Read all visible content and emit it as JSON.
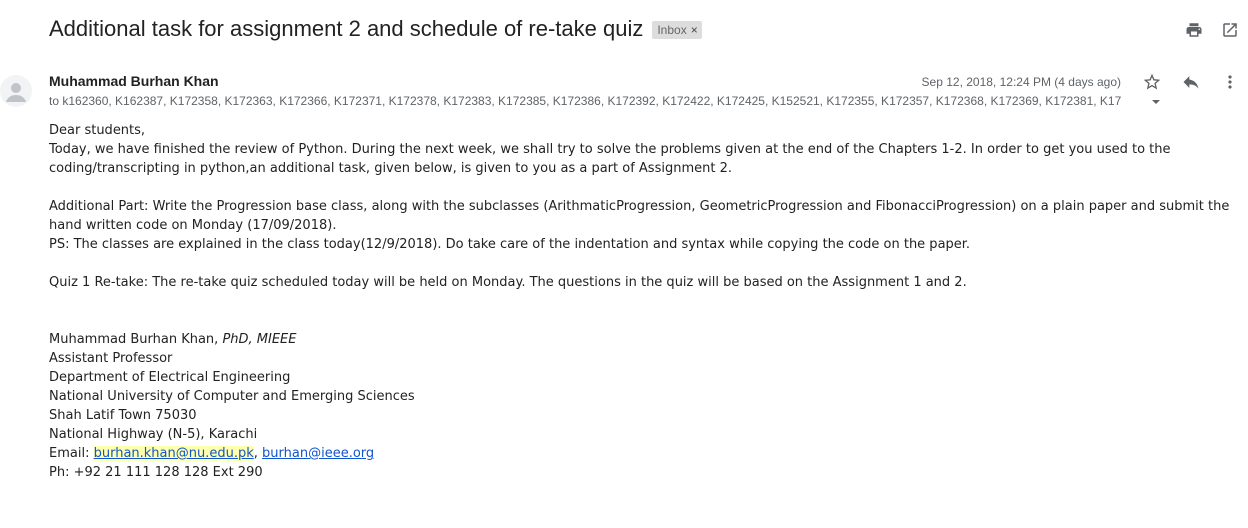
{
  "email": {
    "subject": "Additional task for assignment 2 and schedule of re-take quiz",
    "label": "Inbox",
    "label_remove": "×",
    "sender": "Muhammad Burhan Khan",
    "date": "Sep 12, 2018, 12:24 PM (4 days ago)",
    "recipients": "to k162360, K162387, K172358, K172363, K172366, K172371, K172378, K172383, K172385, K172386, K172392, K172422, K172425, K152521, K172355, K172357, K172368, K172369, K172381, K17",
    "body": {
      "greeting": "Dear students,",
      "p1": "Today, we have finished the review of Python. During the next week, we shall try to solve the problems given at the end of the Chapters 1-2. In order to get you used to the coding/transcripting in python,an additional task, given below, is given to you as a part of Assignment 2.",
      "p2": " Additional Part: Write the Progression base class, along with the subclasses (ArithmaticProgression, GeometricProgression and FibonacciProgression) on a plain paper and submit the hand written code on Monday (17/09/2018).",
      "p3": "PS: The classes are explained in the class today(12/9/2018). Do take care of the indentation and syntax while copying the code on the paper.",
      "p4": "Quiz 1 Re-take: The re-take quiz scheduled today will be held on Monday. The questions in the quiz will be based on the Assignment 1 and 2."
    },
    "signature": {
      "name": "Muhammad Burhan Khan, ",
      "credentials": "PhD, MIEEE",
      "title": "Assistant Professor",
      "department": "Department of Electrical Engineering",
      "university": "National University of Computer and Emerging Sciences",
      "town": "Shah Latif Town 75030",
      "highway": "National Highway (N-5), Karachi",
      "email_label": "Email: ",
      "email1": "burhan.khan@nu.edu.pk",
      "email_sep": ", ",
      "email2": "burhan@ieee.org",
      "phone": "Ph: +92 21 111 128 128 Ext 290"
    }
  },
  "icons": {
    "print": "print-icon",
    "open_new_window": "open-in-new-window-icon",
    "avatar": "person-icon",
    "star": "star-icon",
    "reply": "reply-icon",
    "more": "more-vertical-icon",
    "recipients_caret": "caret-down-icon"
  },
  "colors": {
    "link": "#1155cc",
    "secondary_text": "#5f6368",
    "chip_bg": "#dddddd",
    "email_highlight": "#ffffb0"
  }
}
